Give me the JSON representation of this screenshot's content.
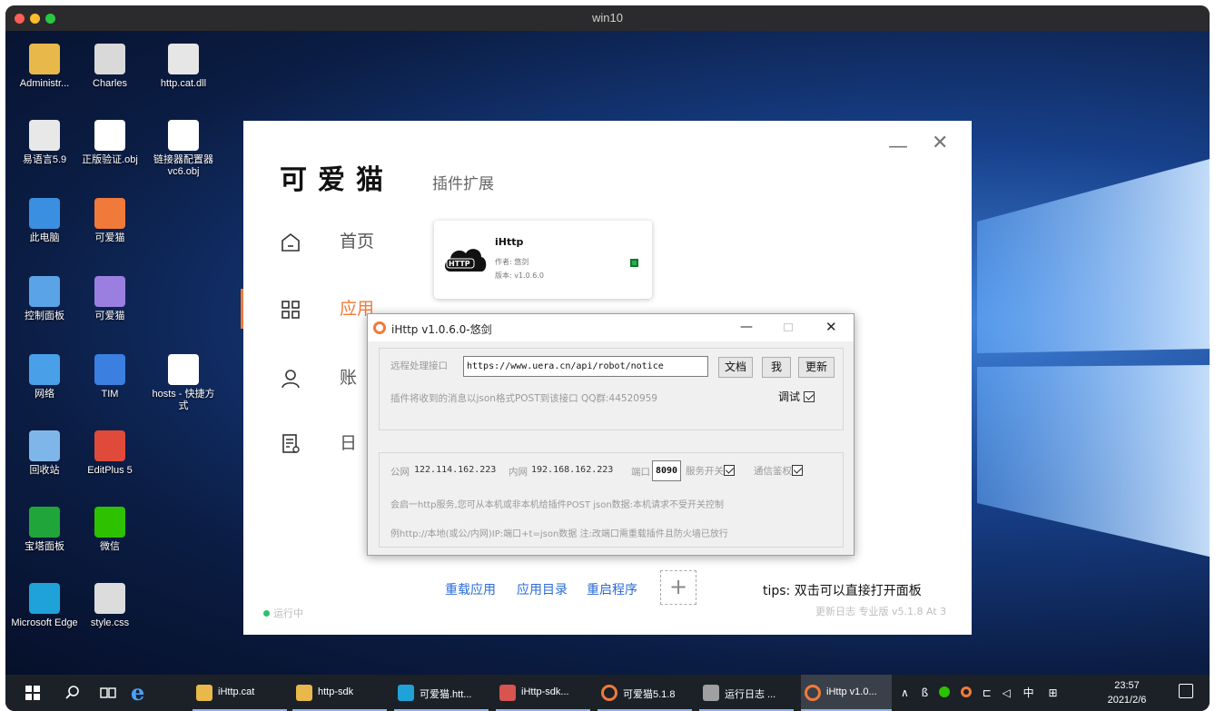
{
  "window": {
    "title": "win10",
    "dot_colors": [
      "#ff5f57",
      "#febc2e",
      "#28c840"
    ]
  },
  "desktop": {
    "icons": [
      {
        "label": "Administr...",
        "icon": "user-folder-icon",
        "color": "#e8b84a"
      },
      {
        "label": "Charles",
        "icon": "charles-icon",
        "color": "#d9d9d9"
      },
      {
        "label": "http.cat.dll",
        "icon": "dll-file-icon",
        "color": "#e6e6e6"
      },
      {
        "label": "易语言5.9",
        "icon": "eyuyan-icon",
        "color": "#e8e8e8"
      },
      {
        "label": "正版验证.obj",
        "icon": "file-icon",
        "color": "#ffffff"
      },
      {
        "label": "链接器配置器vc6.obj",
        "icon": "file-icon",
        "color": "#ffffff"
      },
      {
        "label": "此电脑",
        "icon": "computer-icon",
        "color": "#3b8fe0"
      },
      {
        "label": "可爱猫",
        "icon": "keaimao-shortcut-icon",
        "color": "#f07a3a"
      },
      {
        "label": "控制面板",
        "icon": "control-panel-icon",
        "color": "#5aa3e6"
      },
      {
        "label": "可爱猫",
        "icon": "keaimao-shortcut-icon",
        "color": "#9b7fe0"
      },
      {
        "label": "网络",
        "icon": "network-icon",
        "color": "#4aa0e8"
      },
      {
        "label": "TIM",
        "icon": "tim-icon",
        "color": "#3b7fe0"
      },
      {
        "label": "hosts - 快捷方式",
        "icon": "file-shortcut-icon",
        "color": "#ffffff"
      },
      {
        "label": "回收站",
        "icon": "recycle-bin-icon",
        "color": "#7fb6ea"
      },
      {
        "label": "EditPlus 5",
        "icon": "editplus-icon",
        "color": "#e04a3a"
      },
      {
        "label": "宝塔面板",
        "icon": "baota-icon",
        "color": "#20a53a"
      },
      {
        "label": "微信",
        "icon": "wechat-icon",
        "color": "#2dc100"
      },
      {
        "label": "Microsoft Edge",
        "icon": "edge-icon",
        "color": "#1fa2d8"
      },
      {
        "label": "style.css",
        "icon": "css-file-icon",
        "color": "#dcdcdc"
      }
    ]
  },
  "app": {
    "logo": "可爱猫",
    "section": "插件扩展",
    "accent": "#f07a3a",
    "nav": [
      {
        "label": "首页",
        "icon": "home-icon"
      },
      {
        "label": "应用",
        "icon": "apps-grid-icon"
      },
      {
        "label": "账",
        "icon": "user-icon"
      },
      {
        "label": "日",
        "icon": "log-icon"
      }
    ],
    "plugin_card": {
      "name": "iHttp",
      "badge": "HTTP",
      "author": "作者: 悠剑",
      "version": "版本: v1.0.6.0"
    },
    "bottom_links": [
      "重载应用",
      "应用目录",
      "重启程序"
    ],
    "tips": "tips: 双击可以直接打开面板",
    "version_info": "更新日志 专业版 v5.1.8 At 3",
    "status": "运行中"
  },
  "dialog": {
    "title": "iHttp v1.0.6.0-悠剑",
    "remote_label": "远程处理接口",
    "remote_url": "https://www.uera.cn/api/robot/notice",
    "btn_doc": "文档",
    "btn_me": "我",
    "btn_update": "更新",
    "forward_note": "插件将收到的消息以json格式POST到该接口 QQ群:44520959",
    "debug_label": "调试",
    "public_ip_label": "公网",
    "public_ip": "122.114.162.223",
    "lan_ip_label": "内网",
    "lan_ip": "192.168.162.223",
    "port_label": "端口",
    "port": "8090",
    "service_switch": "服务开关",
    "comm_auth": "通信鉴权",
    "info1": "会启一http服务,您可从本机或非本机给插件POST json数据:本机请求不受开关控制",
    "info2": "例http://本地(或公/内网)IP:端口+t=json数据 注:改端口需重载插件且防火墙已放行"
  },
  "taskbar": {
    "items": [
      {
        "label": "iHttp.cat",
        "icon": "folder-icon",
        "color": "#e8b84a"
      },
      {
        "label": "http-sdk",
        "icon": "folder-icon",
        "color": "#e8b84a"
      },
      {
        "label": "可爱猫.htt...",
        "icon": "edge-icon",
        "color": "#1fa2d8"
      },
      {
        "label": "iHttp-sdk...",
        "icon": "eyuyan-icon",
        "color": "#d9534f"
      },
      {
        "label": "可爱猫5.1.8",
        "icon": "keaimao-icon",
        "color": "#f07a3a"
      },
      {
        "label": "运行日志 ...",
        "icon": "log-window-icon",
        "color": "#a0a0a0"
      },
      {
        "label": "iHttp v1.0...",
        "icon": "keaimao-icon",
        "color": "#f07a3a"
      }
    ],
    "tray_ime": "中",
    "time": "23:57",
    "date": "2021/2/6"
  }
}
